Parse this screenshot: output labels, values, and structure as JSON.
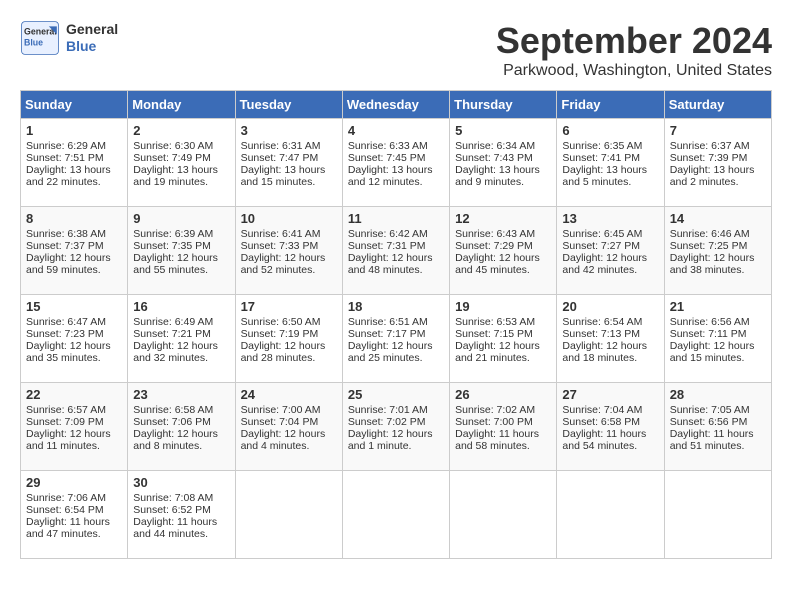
{
  "header": {
    "logo_line1": "General",
    "logo_line2": "Blue",
    "month": "September 2024",
    "location": "Parkwood, Washington, United States"
  },
  "weekdays": [
    "Sunday",
    "Monday",
    "Tuesday",
    "Wednesday",
    "Thursday",
    "Friday",
    "Saturday"
  ],
  "weeks": [
    [
      {
        "day": "1",
        "lines": [
          "Sunrise: 6:29 AM",
          "Sunset: 7:51 PM",
          "Daylight: 13 hours",
          "and 22 minutes."
        ]
      },
      {
        "day": "2",
        "lines": [
          "Sunrise: 6:30 AM",
          "Sunset: 7:49 PM",
          "Daylight: 13 hours",
          "and 19 minutes."
        ]
      },
      {
        "day": "3",
        "lines": [
          "Sunrise: 6:31 AM",
          "Sunset: 7:47 PM",
          "Daylight: 13 hours",
          "and 15 minutes."
        ]
      },
      {
        "day": "4",
        "lines": [
          "Sunrise: 6:33 AM",
          "Sunset: 7:45 PM",
          "Daylight: 13 hours",
          "and 12 minutes."
        ]
      },
      {
        "day": "5",
        "lines": [
          "Sunrise: 6:34 AM",
          "Sunset: 7:43 PM",
          "Daylight: 13 hours",
          "and 9 minutes."
        ]
      },
      {
        "day": "6",
        "lines": [
          "Sunrise: 6:35 AM",
          "Sunset: 7:41 PM",
          "Daylight: 13 hours",
          "and 5 minutes."
        ]
      },
      {
        "day": "7",
        "lines": [
          "Sunrise: 6:37 AM",
          "Sunset: 7:39 PM",
          "Daylight: 13 hours",
          "and 2 minutes."
        ]
      }
    ],
    [
      {
        "day": "8",
        "lines": [
          "Sunrise: 6:38 AM",
          "Sunset: 7:37 PM",
          "Daylight: 12 hours",
          "and 59 minutes."
        ]
      },
      {
        "day": "9",
        "lines": [
          "Sunrise: 6:39 AM",
          "Sunset: 7:35 PM",
          "Daylight: 12 hours",
          "and 55 minutes."
        ]
      },
      {
        "day": "10",
        "lines": [
          "Sunrise: 6:41 AM",
          "Sunset: 7:33 PM",
          "Daylight: 12 hours",
          "and 52 minutes."
        ]
      },
      {
        "day": "11",
        "lines": [
          "Sunrise: 6:42 AM",
          "Sunset: 7:31 PM",
          "Daylight: 12 hours",
          "and 48 minutes."
        ]
      },
      {
        "day": "12",
        "lines": [
          "Sunrise: 6:43 AM",
          "Sunset: 7:29 PM",
          "Daylight: 12 hours",
          "and 45 minutes."
        ]
      },
      {
        "day": "13",
        "lines": [
          "Sunrise: 6:45 AM",
          "Sunset: 7:27 PM",
          "Daylight: 12 hours",
          "and 42 minutes."
        ]
      },
      {
        "day": "14",
        "lines": [
          "Sunrise: 6:46 AM",
          "Sunset: 7:25 PM",
          "Daylight: 12 hours",
          "and 38 minutes."
        ]
      }
    ],
    [
      {
        "day": "15",
        "lines": [
          "Sunrise: 6:47 AM",
          "Sunset: 7:23 PM",
          "Daylight: 12 hours",
          "and 35 minutes."
        ]
      },
      {
        "day": "16",
        "lines": [
          "Sunrise: 6:49 AM",
          "Sunset: 7:21 PM",
          "Daylight: 12 hours",
          "and 32 minutes."
        ]
      },
      {
        "day": "17",
        "lines": [
          "Sunrise: 6:50 AM",
          "Sunset: 7:19 PM",
          "Daylight: 12 hours",
          "and 28 minutes."
        ]
      },
      {
        "day": "18",
        "lines": [
          "Sunrise: 6:51 AM",
          "Sunset: 7:17 PM",
          "Daylight: 12 hours",
          "and 25 minutes."
        ]
      },
      {
        "day": "19",
        "lines": [
          "Sunrise: 6:53 AM",
          "Sunset: 7:15 PM",
          "Daylight: 12 hours",
          "and 21 minutes."
        ]
      },
      {
        "day": "20",
        "lines": [
          "Sunrise: 6:54 AM",
          "Sunset: 7:13 PM",
          "Daylight: 12 hours",
          "and 18 minutes."
        ]
      },
      {
        "day": "21",
        "lines": [
          "Sunrise: 6:56 AM",
          "Sunset: 7:11 PM",
          "Daylight: 12 hours",
          "and 15 minutes."
        ]
      }
    ],
    [
      {
        "day": "22",
        "lines": [
          "Sunrise: 6:57 AM",
          "Sunset: 7:09 PM",
          "Daylight: 12 hours",
          "and 11 minutes."
        ]
      },
      {
        "day": "23",
        "lines": [
          "Sunrise: 6:58 AM",
          "Sunset: 7:06 PM",
          "Daylight: 12 hours",
          "and 8 minutes."
        ]
      },
      {
        "day": "24",
        "lines": [
          "Sunrise: 7:00 AM",
          "Sunset: 7:04 PM",
          "Daylight: 12 hours",
          "and 4 minutes."
        ]
      },
      {
        "day": "25",
        "lines": [
          "Sunrise: 7:01 AM",
          "Sunset: 7:02 PM",
          "Daylight: 12 hours",
          "and 1 minute."
        ]
      },
      {
        "day": "26",
        "lines": [
          "Sunrise: 7:02 AM",
          "Sunset: 7:00 PM",
          "Daylight: 11 hours",
          "and 58 minutes."
        ]
      },
      {
        "day": "27",
        "lines": [
          "Sunrise: 7:04 AM",
          "Sunset: 6:58 PM",
          "Daylight: 11 hours",
          "and 54 minutes."
        ]
      },
      {
        "day": "28",
        "lines": [
          "Sunrise: 7:05 AM",
          "Sunset: 6:56 PM",
          "Daylight: 11 hours",
          "and 51 minutes."
        ]
      }
    ],
    [
      {
        "day": "29",
        "lines": [
          "Sunrise: 7:06 AM",
          "Sunset: 6:54 PM",
          "Daylight: 11 hours",
          "and 47 minutes."
        ]
      },
      {
        "day": "30",
        "lines": [
          "Sunrise: 7:08 AM",
          "Sunset: 6:52 PM",
          "Daylight: 11 hours",
          "and 44 minutes."
        ]
      },
      {
        "day": "",
        "lines": []
      },
      {
        "day": "",
        "lines": []
      },
      {
        "day": "",
        "lines": []
      },
      {
        "day": "",
        "lines": []
      },
      {
        "day": "",
        "lines": []
      }
    ]
  ]
}
